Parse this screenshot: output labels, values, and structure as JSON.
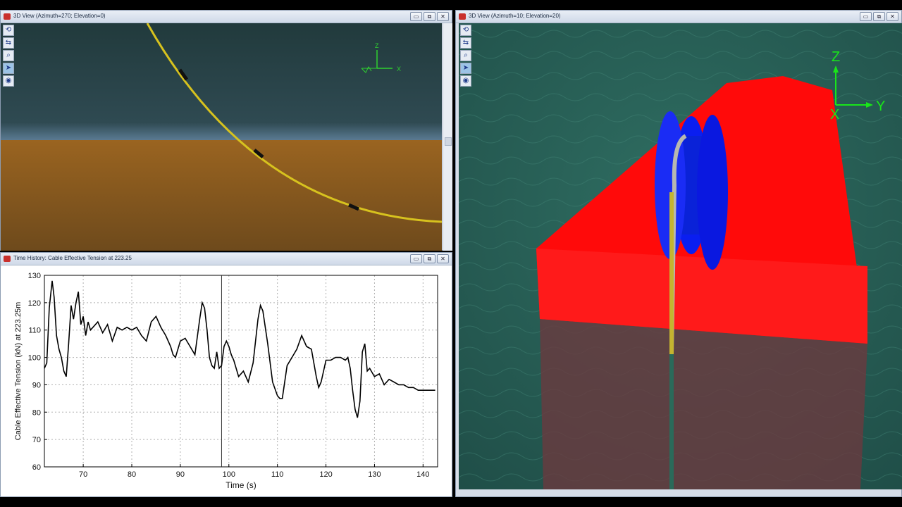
{
  "windows": {
    "view_top": {
      "title": "3D View (Azimuth=270; Elevation=0)",
      "axis_z": "Z",
      "axis_x": "X"
    },
    "view_right": {
      "title": "3D View (Azimuth=10; Elevation=20)",
      "axis_z": "Z",
      "axis_y": "Y",
      "axis_x": "X"
    },
    "time_history": {
      "title": "Time History: Cable Effective Tension at 223.25"
    }
  },
  "window_buttons": {
    "minimize": "▭",
    "maximize": "⧉",
    "close": "✕"
  },
  "toolbar_icons": [
    "orbit-icon",
    "pan-icon",
    "zoom-icon",
    "select-icon",
    "camera-icon"
  ],
  "colors": {
    "sea_dark": "#1d3d3e",
    "seabed": "#8a5a1c",
    "cable": "#c8b51c",
    "vessel": "#ff0a0a",
    "drum": "#0a1ef0",
    "axis_green": "#19e619"
  },
  "chart_data": {
    "type": "line",
    "title": "",
    "xlabel": "Time (s)",
    "ylabel": "Cable Effective Tension (kN) at 223.25m",
    "xlim": [
      62,
      143
    ],
    "ylim": [
      60,
      130
    ],
    "xticks": [
      70,
      80,
      90,
      100,
      110,
      120,
      130,
      140
    ],
    "yticks": [
      60,
      70,
      80,
      90,
      100,
      110,
      120,
      130
    ],
    "grid": true,
    "marker_x": 98.5,
    "series": [
      {
        "x": [
          62.0,
          62.5,
          63.0,
          63.6,
          64.0,
          64.5,
          65.0,
          65.5,
          66.0,
          66.5,
          67.0,
          67.5,
          68.0,
          68.5,
          69.0,
          69.5,
          70.0,
          70.5,
          71.0,
          71.5,
          72.0,
          73.0,
          74.0,
          75.0,
          76.0,
          77.0,
          78.0,
          79.0,
          80.0,
          81.0,
          82.0,
          83.0,
          84.0,
          85.0,
          86.0,
          87.0,
          88.0,
          88.5,
          89.0,
          90.0,
          91.0,
          92.0,
          93.0,
          94.0,
          94.5,
          95.0,
          95.5,
          96.0,
          96.5,
          97.0,
          97.5,
          98.0,
          98.5,
          99.0,
          99.5,
          100.0,
          100.5,
          101.0,
          102.0,
          103.0,
          104.0,
          105.0,
          106.0,
          106.5,
          107.0,
          108.0,
          109.0,
          110.0,
          110.5,
          111.0,
          112.0,
          113.0,
          114.0,
          115.0,
          116.0,
          117.0,
          118.0,
          118.5,
          119.0,
          120.0,
          121.0,
          122.0,
          123.0,
          124.0,
          124.5,
          125.0,
          125.5,
          126.0,
          126.5,
          127.0,
          127.5,
          128.0,
          128.5,
          129.0,
          130.0,
          131.0,
          132.0,
          133.0,
          134.0,
          135.0,
          136.0,
          137.0,
          138.0,
          139.0,
          140.0,
          141.0,
          142.0,
          142.5
        ],
        "y": [
          96,
          98,
          118,
          128,
          122,
          108,
          103,
          100,
          95,
          93,
          105,
          119,
          114,
          120,
          124,
          112,
          115,
          108,
          113,
          110,
          111,
          113,
          109,
          112,
          106,
          111,
          110,
          111,
          110,
          111,
          108,
          106,
          113,
          115,
          111,
          108,
          104,
          101,
          100,
          106,
          107,
          104,
          101,
          114,
          120,
          118,
          110,
          100,
          97,
          96,
          102,
          96,
          97,
          104,
          106,
          104,
          101,
          99,
          93,
          95,
          91,
          98,
          114,
          119,
          117,
          105,
          91,
          86,
          85,
          85,
          97,
          100,
          103,
          108,
          104,
          103,
          93,
          89,
          91,
          99,
          99,
          100,
          100,
          99,
          100,
          96,
          88,
          81,
          78,
          84,
          102,
          105,
          95,
          96,
          93,
          94,
          90,
          92,
          91,
          90,
          90,
          89,
          89,
          88,
          88,
          88,
          88,
          88
        ]
      }
    ]
  }
}
